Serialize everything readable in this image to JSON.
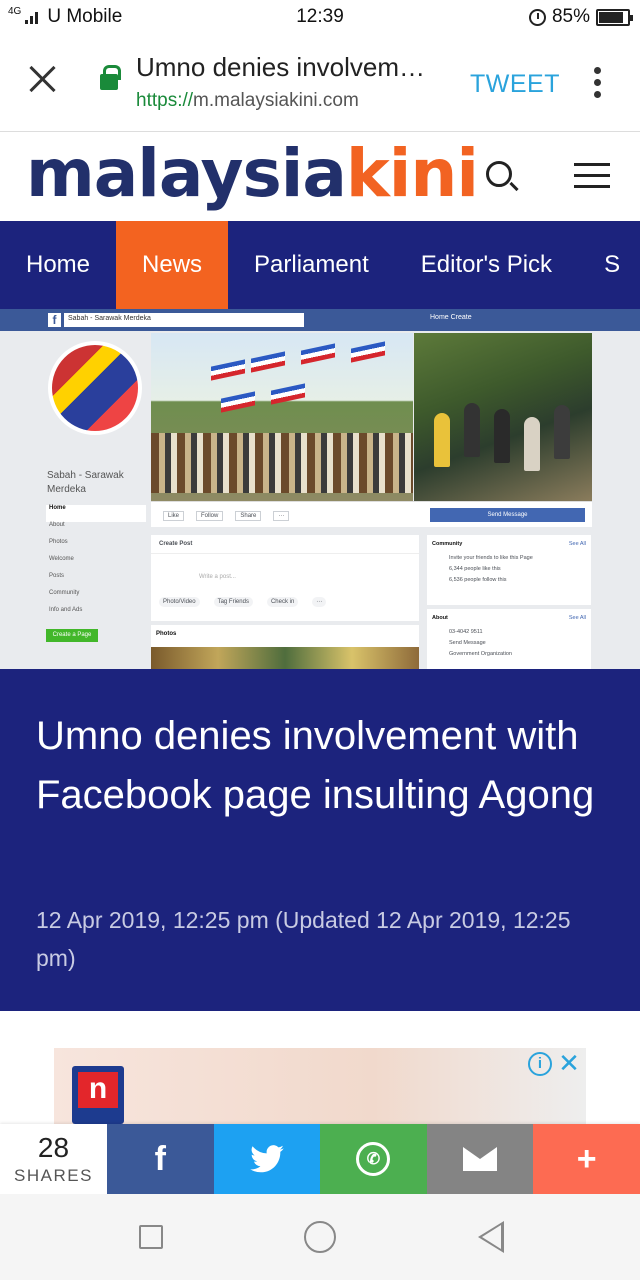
{
  "status_bar": {
    "signal": "4G",
    "carrier": "U Mobile",
    "time": "12:39",
    "battery": "85%",
    "battery_level": 0.85
  },
  "url_bar": {
    "title": "Umno denies involvem…",
    "scheme": "https://",
    "host": "m.malaysiakini.com",
    "tweet_label": "TWEET"
  },
  "brand": {
    "logo_part1": "malaysia",
    "logo_part2": "kini"
  },
  "nav": {
    "items": [
      "Home",
      "News",
      "Parliament",
      "Editor's Pick",
      "S"
    ],
    "active_index": 1
  },
  "hero": {
    "search_text": "Sabah - Sarawak Merdeka",
    "top_nav": "Home    Create",
    "page_name": "Sabah - Sarawak Merdeka",
    "menu": [
      "Home",
      "About",
      "Photos",
      "Welcome",
      "Posts",
      "Community",
      "Info and Ads"
    ],
    "create_page": "Create a Page",
    "actions": [
      "Like",
      "Follow",
      "Share",
      "···"
    ],
    "send_message": "Send Message",
    "create_post": "Create Post",
    "write_post": "Write a post...",
    "post_buttons": [
      "Photo/Video",
      "Tag Friends",
      "Check in",
      "···"
    ],
    "photos": "Photos",
    "community": {
      "title": "Community",
      "see_all": "See All",
      "rows": [
        "Invite your friends to like this Page",
        "6,344 people like this",
        "6,536 people follow this"
      ]
    },
    "about": {
      "title": "About",
      "see_all": "See All",
      "rows": [
        "03-4042 9511",
        "Send Message",
        "Government Organization"
      ]
    }
  },
  "article": {
    "title": "Umno denies involvement with Facebook page insulting Agong",
    "date": "12 Apr 2019, 12:25 pm (Updated 12 Apr 2019, 12:25 pm)"
  },
  "ad": {
    "logo_letter": "n",
    "info_icon": "i",
    "close_icon": "✕"
  },
  "share_bar": {
    "count": "28",
    "label": "SHARES",
    "icons": [
      "facebook-icon",
      "twitter-icon",
      "whatsapp-icon",
      "email-icon",
      "plus-icon"
    ]
  },
  "colors": {
    "navy": "#1c237d",
    "orange": "#f36320",
    "tweet_blue": "#2aa3dc",
    "facebook": "#3b5998",
    "twitter": "#1da1f2",
    "whatsapp": "#4caf50",
    "email": "#848484",
    "plus": "#fd6b52"
  }
}
